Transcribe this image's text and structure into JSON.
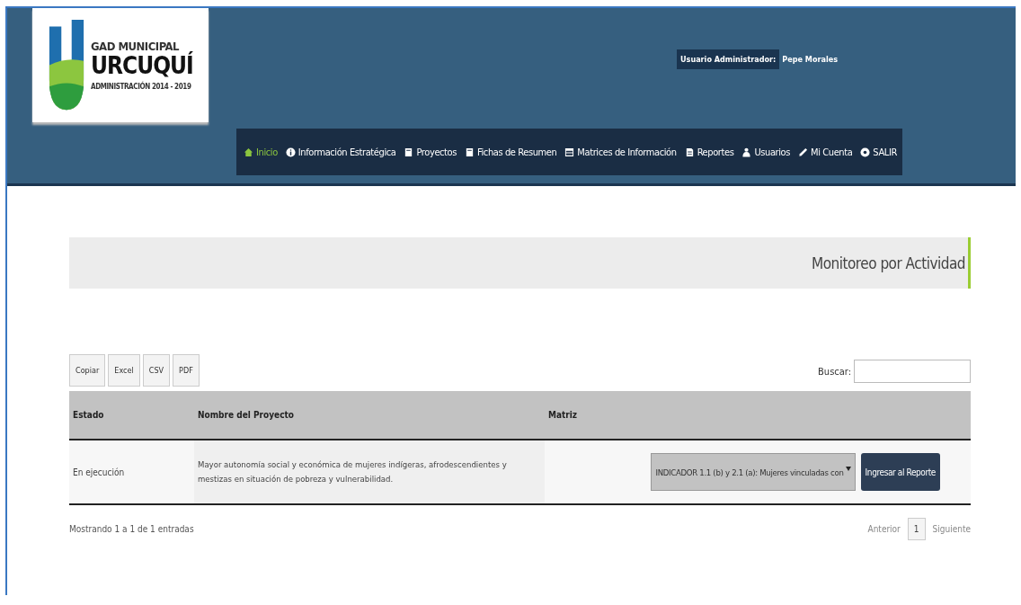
{
  "header": {
    "logo": {
      "line1": "GAD MUNICIPAL",
      "line2": "URCUQUÍ",
      "line3": "ADMINISTRACIÓN 2014 - 2019"
    },
    "user": {
      "label": "Usuario Administrador:",
      "name": "Pepe Morales"
    },
    "nav": [
      {
        "label": "Inicio",
        "kind": "home",
        "selected": true
      },
      {
        "label": "Información Estratégica",
        "kind": "info",
        "selected": false
      },
      {
        "label": "Proyectos",
        "kind": "book",
        "selected": false
      },
      {
        "label": "Fichas de Resumen",
        "kind": "book",
        "selected": false
      },
      {
        "label": "Matrices de Información",
        "kind": "table",
        "selected": false
      },
      {
        "label": "Reportes",
        "kind": "doc",
        "selected": false
      },
      {
        "label": "Usuarios",
        "kind": "user",
        "selected": false
      },
      {
        "label": "Mi Cuenta",
        "kind": "pencil",
        "selected": false
      },
      {
        "label": "SALIR",
        "kind": "gear",
        "selected": false
      }
    ]
  },
  "panel": {
    "title": "Monitoreo por Actividad"
  },
  "export_buttons": [
    "Copiar",
    "Excel",
    "CSV",
    "PDF"
  ],
  "search": {
    "label": "Buscar:"
  },
  "table": {
    "columns": [
      "Estado",
      "Nombre del Proyecto",
      "Matriz"
    ],
    "rows": [
      {
        "estado": "En ejecución",
        "proyecto": "Mayor autonomía social y económica de mujeres indígeras, afrodescendientes y mestizas en situación de pobreza y vulnerabilidad.",
        "matriz": "INDICADOR 1.1 (b) y 2.1 (a): Mujeres vinculadas con",
        "action": "Ingresar al Reporte"
      }
    ]
  },
  "info": "Mostrando 1 a 1 de 1 entradas",
  "pagination": {
    "previous": "Anterior",
    "pages": [
      {
        "label": "1",
        "selected": true
      }
    ],
    "next": "Siguiente"
  }
}
